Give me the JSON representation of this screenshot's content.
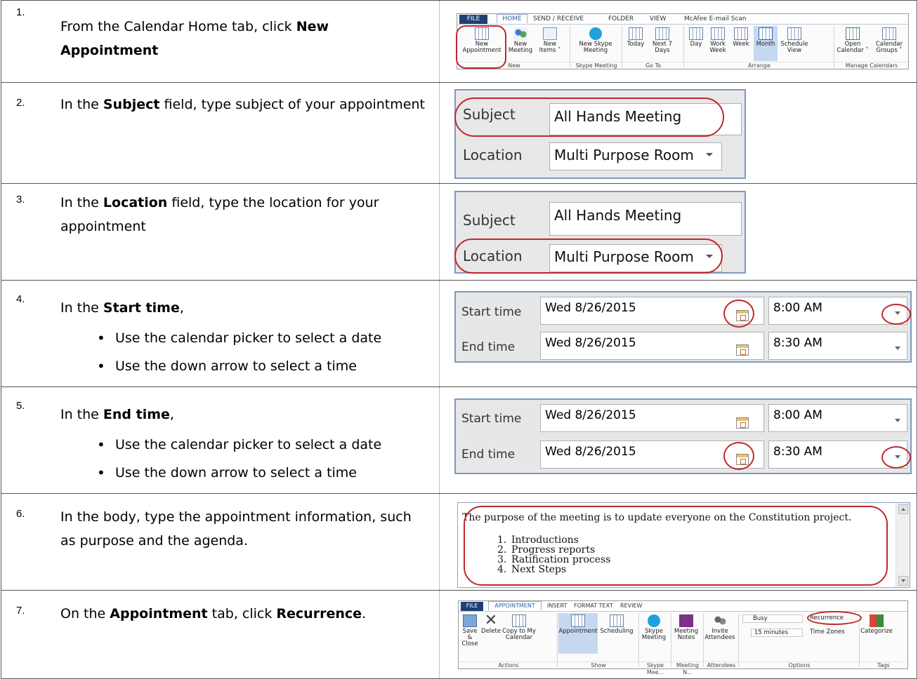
{
  "steps": [
    {
      "num": "1.",
      "pre": "From the Calendar Home tab, click ",
      "bold": "New Appointment",
      "post": ""
    },
    {
      "num": "2.",
      "pre": "In the ",
      "bold": "Subject",
      "post": " field, type subject of your appointment"
    },
    {
      "num": "3.",
      "pre": "In the ",
      "bold": "Location",
      "post": " field, type the location for your appointment"
    },
    {
      "num": "4.",
      "pre": "In the ",
      "bold": "Start time",
      "post": ",",
      "bullets": [
        "Use the calendar picker to select a date",
        "Use the down arrow to select a time"
      ]
    },
    {
      "num": "5.",
      "pre": "In the ",
      "bold": "End time",
      "post": ",",
      "bullets": [
        "Use the calendar picker to select a date",
        "Use the down arrow to select a time"
      ]
    },
    {
      "num": "6.",
      "pre": "In the body, type the appointment information, such as purpose and the agenda.",
      "bold": "",
      "post": ""
    },
    {
      "num": "7.",
      "pre": "On the ",
      "bold": "Appointment",
      "post": " tab, click ",
      "bold2": "Recurrence",
      "post2": "."
    }
  ],
  "ribbon1": {
    "tabs": [
      "FILE",
      "HOME",
      "SEND / RECEIVE",
      "FOLDER",
      "VIEW",
      "McAfee E-mail Scan"
    ],
    "buttons": {
      "new_appointment": [
        "New",
        "Appointment"
      ],
      "new_meeting": [
        "New",
        "Meeting"
      ],
      "new_items": [
        "New",
        "Items ˅"
      ],
      "new_skype": [
        "New Skype",
        "Meeting"
      ],
      "today": [
        "Today",
        ""
      ],
      "next7": [
        "Next 7",
        "Days"
      ],
      "day": [
        "Day",
        ""
      ],
      "work_week": [
        "Work",
        "Week"
      ],
      "week": [
        "Week",
        ""
      ],
      "month": [
        "Month",
        ""
      ],
      "schedule": [
        "Schedule",
        "View"
      ],
      "open_cal": [
        "Open",
        "Calendar ˅"
      ],
      "cal_groups": [
        "Calendar",
        "Groups ˅"
      ]
    },
    "groups": [
      "New",
      "Skype Meeting",
      "Go To",
      "Arrange",
      "Manage Calendars"
    ]
  },
  "form": {
    "subject_label": "Subject",
    "subject_value": "All Hands Meeting",
    "location_label": "Location",
    "location_value": "Multi Purpose Room"
  },
  "times": {
    "start_label": "Start time",
    "end_label": "End time",
    "start_date": "Wed 8/26/2015",
    "end_date": "Wed 8/26/2015",
    "start_time": "8:00 AM",
    "end_time": "8:30 AM"
  },
  "body": {
    "intro": "The purpose of the meeting is to update everyone on the Constitution project.",
    "agenda": [
      {
        "n": "1.",
        "t": "Introductions"
      },
      {
        "n": "2.",
        "t": "Progress reports"
      },
      {
        "n": "3.",
        "t": "Ratification process"
      },
      {
        "n": "4.",
        "t": "Next Steps"
      }
    ]
  },
  "ribbon2": {
    "tabs": [
      "FILE",
      "APPOINTMENT",
      "INSERT",
      "FORMAT TEXT",
      "REVIEW"
    ],
    "buttons": {
      "save_close": [
        "Save &",
        "Close"
      ],
      "delete": [
        "Delete",
        ""
      ],
      "copy_cal": [
        "Copy to My",
        "Calendar"
      ],
      "appointment": [
        "Appointment",
        ""
      ],
      "scheduling": [
        "Scheduling",
        ""
      ],
      "skype": [
        "Skype",
        "Meeting"
      ],
      "meeting_notes": [
        "Meeting",
        "Notes"
      ],
      "invite": [
        "Invite",
        "Attendees"
      ],
      "busy": "Busy",
      "reminder": "15 minutes",
      "recurrence": "Recurrence",
      "time_zones": "Time Zones",
      "categorize": "Categorize"
    },
    "groups": [
      "Actions",
      "Show",
      "Skype Mee...",
      "Meeting N...",
      "Attendees",
      "Options",
      "Tags"
    ]
  }
}
